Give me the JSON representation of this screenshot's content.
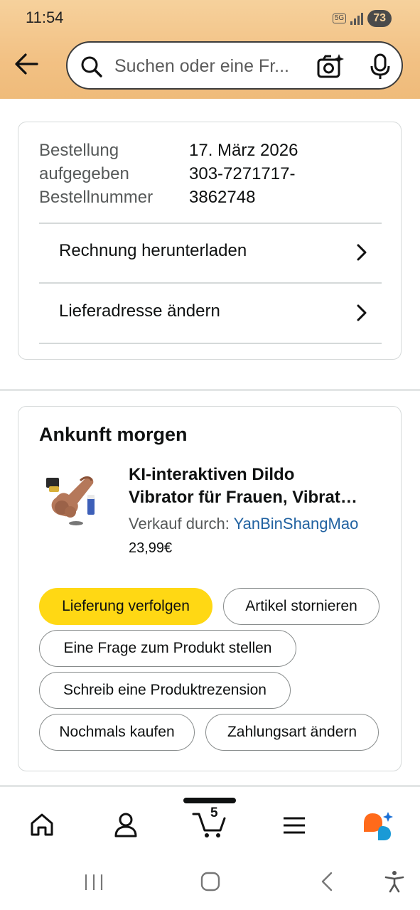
{
  "status_bar": {
    "time": "11:54",
    "network": "5G",
    "battery": "73"
  },
  "search": {
    "placeholder": "Suchen oder eine Fr..."
  },
  "order_info": {
    "placed_label": "Bestellung aufgegeben",
    "placed_label_line1": "Bestellung",
    "placed_label_line2": "aufgegeben",
    "placed_date": "17. März 2026",
    "number_label": "Bestellnummer",
    "order_number_line1": "303-7271717-",
    "order_number_line2": "3862748",
    "download_invoice": "Rechnung herunterladen",
    "change_address": "Lieferadresse ändern"
  },
  "shipment": {
    "arrival": "Ankunft morgen",
    "product_title_line1": "KI-interaktiven Dildo",
    "product_title_line2": "Vibrator für Frauen, Vibrat…",
    "sold_by_label": "Verkauf durch:",
    "seller": "YanBinShangMao",
    "price": "23,99€",
    "buttons": {
      "track": "Lieferung verfolgen",
      "cancel": "Artikel stornieren",
      "question": "Eine Frage zum Produkt stellen",
      "review": "Schreib eine Produktrezension",
      "buy_again": "Nochmals kaufen",
      "change_payment": "Zahlungsart ändern"
    }
  },
  "bottom_nav": {
    "cart_count": "5"
  },
  "colors": {
    "header_bg": "#f2c184",
    "primary_button": "#ffd814",
    "link": "#2162a1"
  }
}
